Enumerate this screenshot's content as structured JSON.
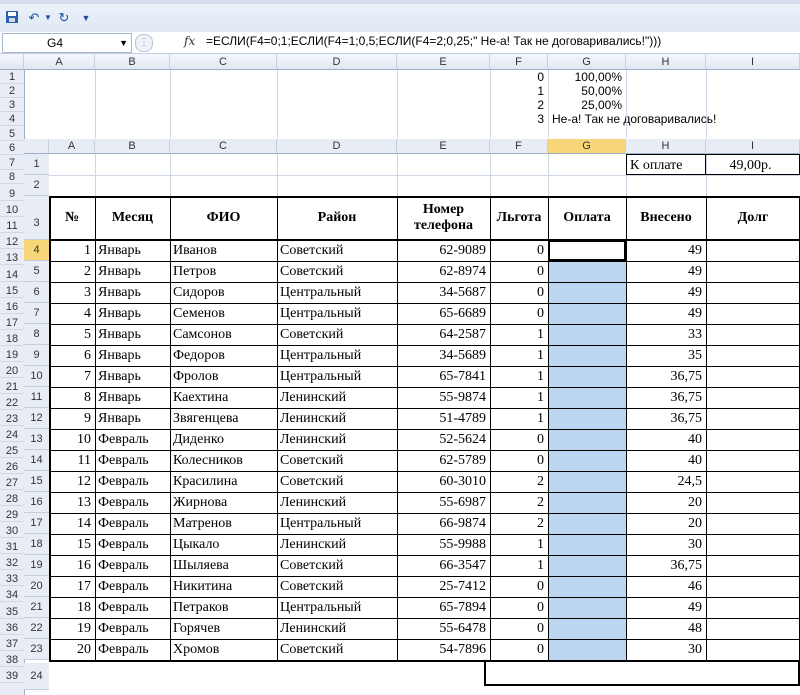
{
  "toolbar": {
    "save_icon": "save-icon",
    "undo_icon": "undo-icon",
    "redo_icon": "redo-icon"
  },
  "formula_bar": {
    "name_box": "G4",
    "fx_label": "fx",
    "formula": "=ЕСЛИ(F4=0;1;ЕСЛИ(F4=1;0,5;ЕСЛИ(F4=2;0,25;\" Не-а! Так не договаривались!\")))"
  },
  "outer_columns": [
    "A",
    "B",
    "C",
    "D",
    "E",
    "F",
    "G",
    "H",
    "I"
  ],
  "outer_rows": [
    "1",
    "2",
    "3",
    "4",
    "5",
    "6",
    "7",
    "8",
    "9",
    "10",
    "11",
    "12",
    "13",
    "14",
    "15",
    "16",
    "17",
    "18",
    "19",
    "20",
    "21",
    "22",
    "23",
    "24",
    "25",
    "26",
    "27",
    "28",
    "29",
    "30",
    "31",
    "32",
    "33",
    "34",
    "35",
    "36",
    "37",
    "38",
    "39"
  ],
  "lookup": [
    {
      "f": "0",
      "g": "100,00%"
    },
    {
      "f": "1",
      "g": "50,00%"
    },
    {
      "f": "2",
      "g": "25,00%"
    },
    {
      "f": "3",
      "g": "Не-а! Так не договаривались!"
    }
  ],
  "inner_columns": [
    "A",
    "B",
    "C",
    "D",
    "E",
    "F",
    "G",
    "H",
    "I"
  ],
  "inner_rows": [
    "1",
    "2",
    "3",
    "4",
    "5",
    "6",
    "7",
    "8",
    "9",
    "10",
    "11",
    "12",
    "13",
    "14",
    "15",
    "16",
    "17",
    "18",
    "19",
    "20",
    "21",
    "22",
    "23",
    "24"
  ],
  "payment": {
    "label": "К оплате",
    "value": "49,00р."
  },
  "table_headers": {
    "no": "№",
    "month": "Месяц",
    "name": "ФИО",
    "district": "Район",
    "phone": "Номер телефона",
    "benefit": "Льгота",
    "payment": "Оплата",
    "paid": "Внесено",
    "debt": "Долг"
  },
  "rows": [
    {
      "no": "1",
      "month": "Январь",
      "name": "Иванов",
      "district": "Советский",
      "phone": "62-9089",
      "benefit": "0",
      "paid": "49"
    },
    {
      "no": "2",
      "month": "Январь",
      "name": "Петров",
      "district": "Советский",
      "phone": "62-8974",
      "benefit": "0",
      "paid": "49"
    },
    {
      "no": "3",
      "month": "Январь",
      "name": "Сидоров",
      "district": "Центральный",
      "phone": "34-5687",
      "benefit": "0",
      "paid": "49"
    },
    {
      "no": "4",
      "month": "Январь",
      "name": "Семенов",
      "district": "Центральный",
      "phone": "65-6689",
      "benefit": "0",
      "paid": "49"
    },
    {
      "no": "5",
      "month": "Январь",
      "name": "Самсонов",
      "district": "Советский",
      "phone": "64-2587",
      "benefit": "1",
      "paid": "33"
    },
    {
      "no": "6",
      "month": "Январь",
      "name": "Федоров",
      "district": "Центральный",
      "phone": "34-5689",
      "benefit": "1",
      "paid": "35"
    },
    {
      "no": "7",
      "month": "Январь",
      "name": "Фролов",
      "district": "Центральный",
      "phone": "65-7841",
      "benefit": "1",
      "paid": "36,75"
    },
    {
      "no": "8",
      "month": "Январь",
      "name": "Каехтина",
      "district": "Ленинский",
      "phone": "55-9874",
      "benefit": "1",
      "paid": "36,75"
    },
    {
      "no": "9",
      "month": "Январь",
      "name": "Звягенцева",
      "district": "Ленинский",
      "phone": "51-4789",
      "benefit": "1",
      "paid": "36,75"
    },
    {
      "no": "10",
      "month": "Февраль",
      "name": "Диденко",
      "district": "Ленинский",
      "phone": "52-5624",
      "benefit": "0",
      "paid": "40"
    },
    {
      "no": "11",
      "month": "Февраль",
      "name": "Колесников",
      "district": "Советский",
      "phone": "62-5789",
      "benefit": "0",
      "paid": "40"
    },
    {
      "no": "12",
      "month": "Февраль",
      "name": "Красилина",
      "district": "Советский",
      "phone": "60-3010",
      "benefit": "2",
      "paid": "24,5"
    },
    {
      "no": "13",
      "month": "Февраль",
      "name": "Жирнова",
      "district": "Ленинский",
      "phone": "55-6987",
      "benefit": "2",
      "paid": "20"
    },
    {
      "no": "14",
      "month": "Февраль",
      "name": "Матренов",
      "district": "Центральный",
      "phone": "66-9874",
      "benefit": "2",
      "paid": "20"
    },
    {
      "no": "15",
      "month": "Февраль",
      "name": "Цыкало",
      "district": "Ленинский",
      "phone": "55-9988",
      "benefit": "1",
      "paid": "30"
    },
    {
      "no": "16",
      "month": "Февраль",
      "name": "Шыляева",
      "district": "Советский",
      "phone": "66-3547",
      "benefit": "1",
      "paid": "36,75"
    },
    {
      "no": "17",
      "month": "Февраль",
      "name": "Никитина",
      "district": "Советский",
      "phone": "25-7412",
      "benefit": "0",
      "paid": "46"
    },
    {
      "no": "18",
      "month": "Февраль",
      "name": "Петраков",
      "district": "Центральный",
      "phone": "65-7894",
      "benefit": "0",
      "paid": "49"
    },
    {
      "no": "19",
      "month": "Февраль",
      "name": "Горячев",
      "district": "Ленинский",
      "phone": "55-6478",
      "benefit": "0",
      "paid": "48"
    },
    {
      "no": "20",
      "month": "Февраль",
      "name": "Хромов",
      "district": "Советский",
      "phone": "54-7896",
      "benefit": "0",
      "paid": "30"
    }
  ]
}
